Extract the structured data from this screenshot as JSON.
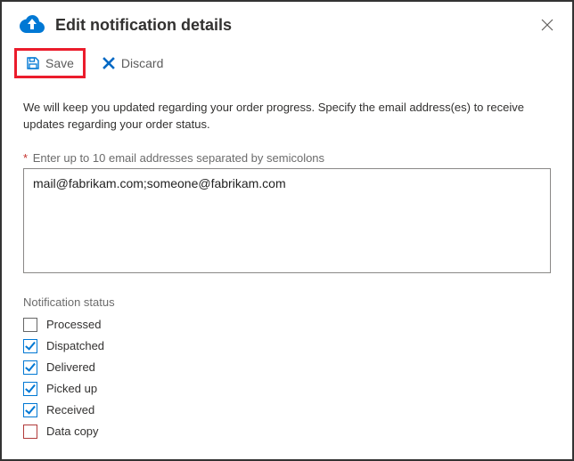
{
  "header": {
    "title": "Edit notification details"
  },
  "toolbar": {
    "save_label": "Save",
    "discard_label": "Discard"
  },
  "description": "We will keep you updated regarding your order progress. Specify the email address(es) to receive updates regarding your order status.",
  "email_field": {
    "label": "Enter up to 10 email addresses separated by semicolons",
    "required_marker": "*",
    "value": "mail@fabrikam.com;someone@fabrikam.com"
  },
  "status_section": {
    "heading": "Notification status",
    "items": [
      {
        "label": "Processed",
        "checked": false
      },
      {
        "label": "Dispatched",
        "checked": true
      },
      {
        "label": "Delivered",
        "checked": true
      },
      {
        "label": "Picked up",
        "checked": true
      },
      {
        "label": "Received",
        "checked": true
      },
      {
        "label": "Data copy",
        "checked": false
      }
    ]
  },
  "colors": {
    "accent": "#0078d4",
    "danger": "#eb1c2c"
  }
}
